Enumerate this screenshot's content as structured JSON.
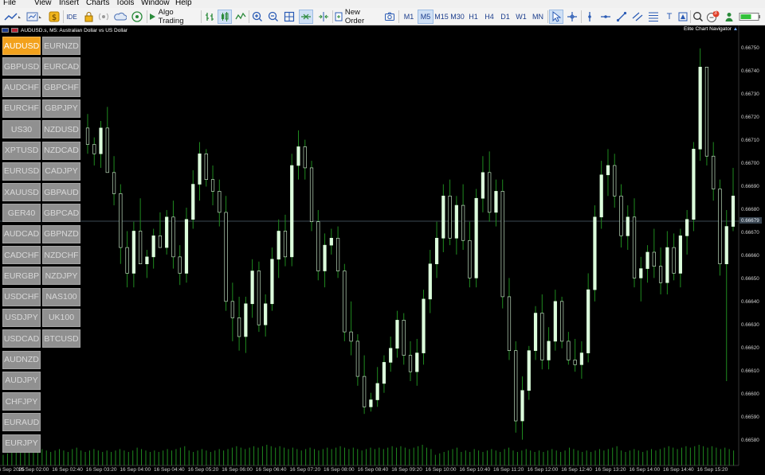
{
  "menu": [
    "File",
    "View",
    "Insert",
    "Charts",
    "Tools",
    "Window",
    "Help"
  ],
  "toolbar": {
    "algo_trading": "Algo Trading",
    "new_order": "New Order",
    "timeframes": [
      "M1",
      "M5",
      "M15",
      "M30",
      "H1",
      "H4",
      "D1",
      "W1",
      "MN"
    ],
    "active_timeframe": "M5",
    "notification_count": "3"
  },
  "chart": {
    "symbol_title": "AUDUSD.s, M5:  Australian Dollar vs US Dollar",
    "navigator_label": "Elite Chart Navigator",
    "current_price": "0.66679",
    "colors": {
      "bull": "#dcffdc",
      "wick": "#1f8a1f",
      "volume": "#1f8a1f",
      "bid_line": "#3c4a55",
      "active_symbol": "#f2a11c"
    }
  },
  "symbols": [
    [
      "AUDUSD",
      "EURNZD"
    ],
    [
      "GBPUSD",
      "EURCAD"
    ],
    [
      "AUDCHF",
      "GBPCHF"
    ],
    [
      "EURCHF",
      "GBPJPY"
    ],
    [
      "US30",
      "NZDUSD"
    ],
    [
      "XPTUSD",
      "NZDCAD"
    ],
    [
      "EURUSD",
      "CADJPY"
    ],
    [
      "XAUUSD",
      "GBPAUD"
    ],
    [
      "GER40",
      "GBPCAD"
    ],
    [
      "AUDCAD",
      "GBPNZD"
    ],
    [
      "CADCHF",
      "NZDCHF"
    ],
    [
      "EURGBP",
      "NZDJPY"
    ],
    [
      "USDCHF",
      "NAS100"
    ],
    [
      "USDJPY",
      "UK100"
    ],
    [
      "USDCAD",
      "BTCUSD"
    ],
    [
      "AUDNZD"
    ],
    [
      "AUDJPY"
    ],
    [
      "CHFJPY"
    ],
    [
      "EURAUD"
    ],
    [
      "EURJPY"
    ]
  ],
  "active_symbol": "AUDUSD",
  "price_axis": [
    "0.66750",
    "0.66740",
    "0.66730",
    "0.66720",
    "0.66710",
    "0.66700",
    "0.66690",
    "0.66680",
    "0.66670",
    "0.66660",
    "0.66650",
    "0.66640",
    "0.66630",
    "0.66620",
    "0.66610",
    "0.66600",
    "0.66590",
    "0.66580"
  ],
  "time_axis": [
    "16 Sep 2025",
    "16 Sep 02:00",
    "16 Sep 02:40",
    "16 Sep 03:20",
    "16 Sep 04:00",
    "16 Sep 04:40",
    "16 Sep 05:20",
    "16 Sep 06:00",
    "16 Sep 06:40",
    "16 Sep 07:20",
    "16 Sep 08:00",
    "16 Sep 08:40",
    "16 Sep 09:20",
    "16 Sep 10:00",
    "16 Sep 10:40",
    "16 Sep 11:20",
    "16 Sep 12:00",
    "16 Sep 12:40",
    "16 Sep 13:20",
    "16 Sep 14:00",
    "16 Sep 14:40",
    "16 Sep 15:20"
  ],
  "chart_data": {
    "type": "candlestick",
    "x_start": "16 Sep 2025 01:20",
    "interval": "5 minutes",
    "y_range": [
      0.66575,
      0.66758
    ],
    "price_scale_unit": 0.0001,
    "candles": [
      [
        0.66719,
        0.66725,
        0.66708,
        0.66712
      ],
      [
        0.66712,
        0.66715,
        0.66703,
        0.66708
      ],
      [
        0.66708,
        0.66722,
        0.66702,
        0.66719
      ],
      [
        0.66719,
        0.66728,
        0.66705,
        0.667
      ],
      [
        0.667,
        0.66707,
        0.66686,
        0.66691
      ],
      [
        0.66691,
        0.66695,
        0.66661,
        0.66668
      ],
      [
        0.66668,
        0.66675,
        0.66651,
        0.66657
      ],
      [
        0.66657,
        0.66679,
        0.66651,
        0.66675
      ],
      [
        0.66675,
        0.66689,
        0.66665,
        0.66661
      ],
      [
        0.66661,
        0.66667,
        0.66655,
        0.66664
      ],
      [
        0.66664,
        0.66676,
        0.66659,
        0.66673
      ],
      [
        0.66673,
        0.66683,
        0.66669,
        0.66668
      ],
      [
        0.66668,
        0.66684,
        0.66665,
        0.66681
      ],
      [
        0.66681,
        0.66688,
        0.66659,
        0.66664
      ],
      [
        0.66664,
        0.66669,
        0.66652,
        0.66657
      ],
      [
        0.66657,
        0.66685,
        0.66653,
        0.6668
      ],
      [
        0.6668,
        0.66701,
        0.66676,
        0.66695
      ],
      [
        0.66695,
        0.66713,
        0.66688,
        0.66708
      ],
      [
        0.66708,
        0.6671,
        0.66694,
        0.66697
      ],
      [
        0.66697,
        0.66703,
        0.66686,
        0.66692
      ],
      [
        0.66692,
        0.66697,
        0.66677,
        0.66683
      ],
      [
        0.66683,
        0.6669,
        0.66641,
        0.66645
      ],
      [
        0.66645,
        0.66653,
        0.66628,
        0.66638
      ],
      [
        0.66638,
        0.66647,
        0.66624,
        0.6663
      ],
      [
        0.6663,
        0.66647,
        0.66623,
        0.66644
      ],
      [
        0.66644,
        0.66663,
        0.66638,
        0.66658
      ],
      [
        0.66658,
        0.66662,
        0.66632,
        0.66635
      ],
      [
        0.66635,
        0.66648,
        0.6663,
        0.66644
      ],
      [
        0.66644,
        0.66668,
        0.66641,
        0.66663
      ],
      [
        0.66663,
        0.6668,
        0.66655,
        0.66675
      ],
      [
        0.66675,
        0.66682,
        0.6666,
        0.66664
      ],
      [
        0.66664,
        0.66708,
        0.6666,
        0.66703
      ],
      [
        0.66703,
        0.66718,
        0.66697,
        0.66711
      ],
      [
        0.66711,
        0.66714,
        0.66697,
        0.66702
      ],
      [
        0.66702,
        0.66705,
        0.66675,
        0.66679
      ],
      [
        0.66679,
        0.66684,
        0.66654,
        0.66658
      ],
      [
        0.66658,
        0.66674,
        0.66651,
        0.66669
      ],
      [
        0.66669,
        0.66676,
        0.66665,
        0.66672
      ],
      [
        0.66672,
        0.66677,
        0.66655,
        0.66658
      ],
      [
        0.66658,
        0.66661,
        0.66628,
        0.66632
      ],
      [
        0.66632,
        0.66645,
        0.66622,
        0.66628
      ],
      [
        0.66628,
        0.66631,
        0.66609,
        0.66613
      ],
      [
        0.66613,
        0.66622,
        0.66597,
        0.666
      ],
      [
        0.666,
        0.66606,
        0.66598,
        0.66603
      ],
      [
        0.66603,
        0.66617,
        0.666,
        0.6661
      ],
      [
        0.6661,
        0.66622,
        0.66606,
        0.66619
      ],
      [
        0.66619,
        0.6663,
        0.66615,
        0.66625
      ],
      [
        0.66625,
        0.66641,
        0.66621,
        0.66637
      ],
      [
        0.66637,
        0.6664,
        0.66618,
        0.66622
      ],
      [
        0.66622,
        0.66628,
        0.66611,
        0.66615
      ],
      [
        0.66615,
        0.66629,
        0.66609,
        0.66623
      ],
      [
        0.66623,
        0.6665,
        0.66618,
        0.66646
      ],
      [
        0.66646,
        0.66667,
        0.6664,
        0.66661
      ],
      [
        0.66661,
        0.66679,
        0.66655,
        0.66672
      ],
      [
        0.66672,
        0.66695,
        0.66666,
        0.6669
      ],
      [
        0.6669,
        0.66697,
        0.66669,
        0.66672
      ],
      [
        0.66672,
        0.6669,
        0.66665,
        0.66686
      ],
      [
        0.66686,
        0.66695,
        0.66667,
        0.66671
      ],
      [
        0.66671,
        0.66679,
        0.66651,
        0.66655
      ],
      [
        0.66655,
        0.66693,
        0.66651,
        0.66689
      ],
      [
        0.66689,
        0.66707,
        0.66683,
        0.667
      ],
      [
        0.667,
        0.66709,
        0.66679,
        0.66683
      ],
      [
        0.66683,
        0.66697,
        0.66677,
        0.66692
      ],
      [
        0.66692,
        0.66697,
        0.66642,
        0.66647
      ],
      [
        0.66647,
        0.66655,
        0.6662,
        0.66624
      ],
      [
        0.66624,
        0.66628,
        0.66589,
        0.66594
      ],
      [
        0.66594,
        0.66613,
        0.66586,
        0.66607
      ],
      [
        0.66607,
        0.66626,
        0.66603,
        0.66624
      ],
      [
        0.66624,
        0.66643,
        0.6662,
        0.6664
      ],
      [
        0.6664,
        0.66648,
        0.66616,
        0.6662
      ],
      [
        0.6662,
        0.66634,
        0.66616,
        0.66628
      ],
      [
        0.66628,
        0.6665,
        0.66624,
        0.66645
      ],
      [
        0.66645,
        0.66647,
        0.66625,
        0.66628
      ],
      [
        0.66628,
        0.66632,
        0.66618,
        0.6662
      ],
      [
        0.6662,
        0.66629,
        0.66615,
        0.66618
      ],
      [
        0.66618,
        0.66628,
        0.66612,
        0.66623
      ],
      [
        0.66623,
        0.66657,
        0.66619,
        0.6665
      ],
      [
        0.6665,
        0.66686,
        0.66645,
        0.66681
      ],
      [
        0.66681,
        0.66705,
        0.66676,
        0.66699
      ],
      [
        0.66699,
        0.6671,
        0.6669,
        0.66703
      ],
      [
        0.66703,
        0.66708,
        0.66685,
        0.6669
      ],
      [
        0.6669,
        0.66695,
        0.66668,
        0.66673
      ],
      [
        0.66673,
        0.66686,
        0.66667,
        0.66681
      ],
      [
        0.66681,
        0.66689,
        0.66651,
        0.66655
      ],
      [
        0.66655,
        0.66664,
        0.66645,
        0.66659
      ],
      [
        0.66659,
        0.66669,
        0.66653,
        0.66666
      ],
      [
        0.66666,
        0.66676,
        0.66655,
        0.6666
      ],
      [
        0.6666,
        0.66668,
        0.66648,
        0.66653
      ],
      [
        0.66653,
        0.66675,
        0.66648,
        0.66668
      ],
      [
        0.66668,
        0.66674,
        0.66654,
        0.66657
      ],
      [
        0.66657,
        0.66676,
        0.66651,
        0.66673
      ],
      [
        0.66673,
        0.66684,
        0.66665,
        0.6668
      ],
      [
        0.6668,
        0.66713,
        0.66675,
        0.6671
      ],
      [
        0.6671,
        0.66753,
        0.66705,
        0.66745
      ],
      [
        0.66745,
        0.66733,
        0.66703,
        0.66707
      ],
      [
        0.66707,
        0.66713,
        0.66688,
        0.66693
      ],
      [
        0.66693,
        0.66697,
        0.66656,
        0.66661
      ],
      [
        0.66661,
        0.66684,
        0.66611,
        0.66677
      ],
      [
        0.66677,
        0.66702,
        0.66675,
        0.6669
      ]
    ],
    "volume_relative": [
      0.3,
      0.4,
      0.5,
      0.6,
      0.7,
      0.8,
      0.5,
      0.6,
      0.5,
      0.7,
      0.6,
      0.5,
      0.6,
      0.7,
      0.6,
      0.5,
      0.7,
      0.8,
      0.6,
      0.5,
      0.6,
      0.7,
      0.6,
      0.5,
      0.6,
      0.5,
      0.6,
      0.7,
      0.6,
      0.5,
      0.6,
      0.8,
      0.7,
      0.6,
      0.5,
      0.6,
      0.5,
      0.6,
      0.7,
      0.6,
      0.7,
      0.8,
      0.9,
      0.6,
      0.5,
      0.6,
      0.7,
      0.6,
      0.5,
      0.6,
      0.7,
      0.6,
      0.7,
      0.8,
      0.9,
      0.8,
      0.7,
      0.8,
      0.9,
      0.8,
      0.9,
      1.0,
      0.9,
      0.8,
      0.9,
      0.8,
      0.7,
      0.8,
      0.7,
      0.6,
      0.7,
      0.8,
      0.7,
      0.6,
      0.7,
      0.8,
      0.7,
      0.8,
      0.9,
      0.8,
      0.7,
      0.8,
      0.7,
      0.6,
      0.7,
      0.8,
      0.7,
      0.8,
      0.7,
      0.8,
      0.9,
      0.8,
      0.9,
      0.8,
      0.7,
      0.8,
      0.9,
      1.0,
      0.8,
      0.7
    ]
  }
}
